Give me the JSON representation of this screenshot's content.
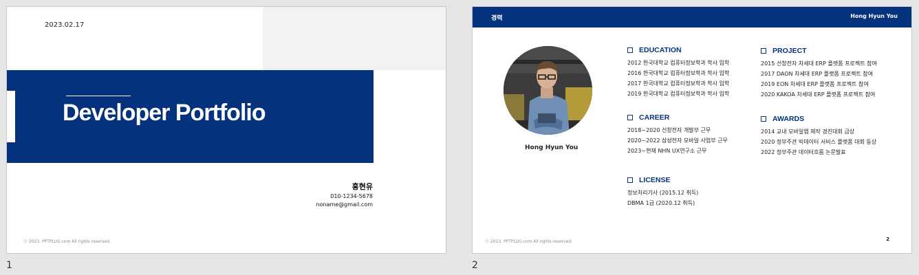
{
  "slides": [
    {
      "number": "1",
      "date": "2023.02.17",
      "title": "Developer Portfolio",
      "name": "홍현유",
      "phone": "010-1234-5678",
      "email": "noname@gmail.com",
      "footer": "ⓒ 2023. PPTPLUG.com All rights reserved."
    },
    {
      "number": "2",
      "header_left": "경력",
      "header_right": "Hong Hyun You",
      "person_name": "Hong Hyun You",
      "footer": "ⓒ 2023. PPTPLUG.com All rights reserved.",
      "page": "2",
      "sections": {
        "education": {
          "title": "EDUCATION",
          "items": [
            "2012 한국대학교 컴퓨터정보학과 학사 입학",
            "2016 한국대학교 컴퓨터정보학과 학사 입학",
            "2017 한국대학교 컴퓨터정보학과 학사 입학",
            "2019 한국대학교 컴퓨터정보학과 학사 입학"
          ]
        },
        "project": {
          "title": "PROJECT",
          "items": [
            "2015 선창전자 차세대 ERP 플랫폼 프로젝트 참여",
            "2017 DAON 차세대 ERP 플랫폼 프로젝트 참여",
            "2019 EON 차세대 ERP 플랫폼 프로젝트 참여",
            "2020 KAKOA 차세대 ERP 플랫폼 프로젝트 참여"
          ]
        },
        "career": {
          "title": "CAREER",
          "items": [
            "2018~2020 선창전자 개발부 근무",
            "2020~2022 삼성전자 모바일 사업부 근무",
            "2023~현재 NHN UX연구소 근무"
          ]
        },
        "awards": {
          "title": "AWARDS",
          "items": [
            "2014 교내 모바일앱 제작 경진대회 금상",
            "2020 정부주관 빅데이터 서비스 플랫폼 대회 동상",
            "2022 정부주관 데이터흐름 논문발표"
          ]
        },
        "license": {
          "title": "LICENSE",
          "items": [
            "정보처리기사 (2015.12 취득)",
            "DBMA 1급 (2020.12 취득)"
          ]
        }
      }
    }
  ],
  "colors": {
    "brand_blue": "#04327d",
    "workspace_gray": "#e6e6e6"
  },
  "icons": {
    "section_marker": "square-outline-icon",
    "photo": "person-photo"
  }
}
